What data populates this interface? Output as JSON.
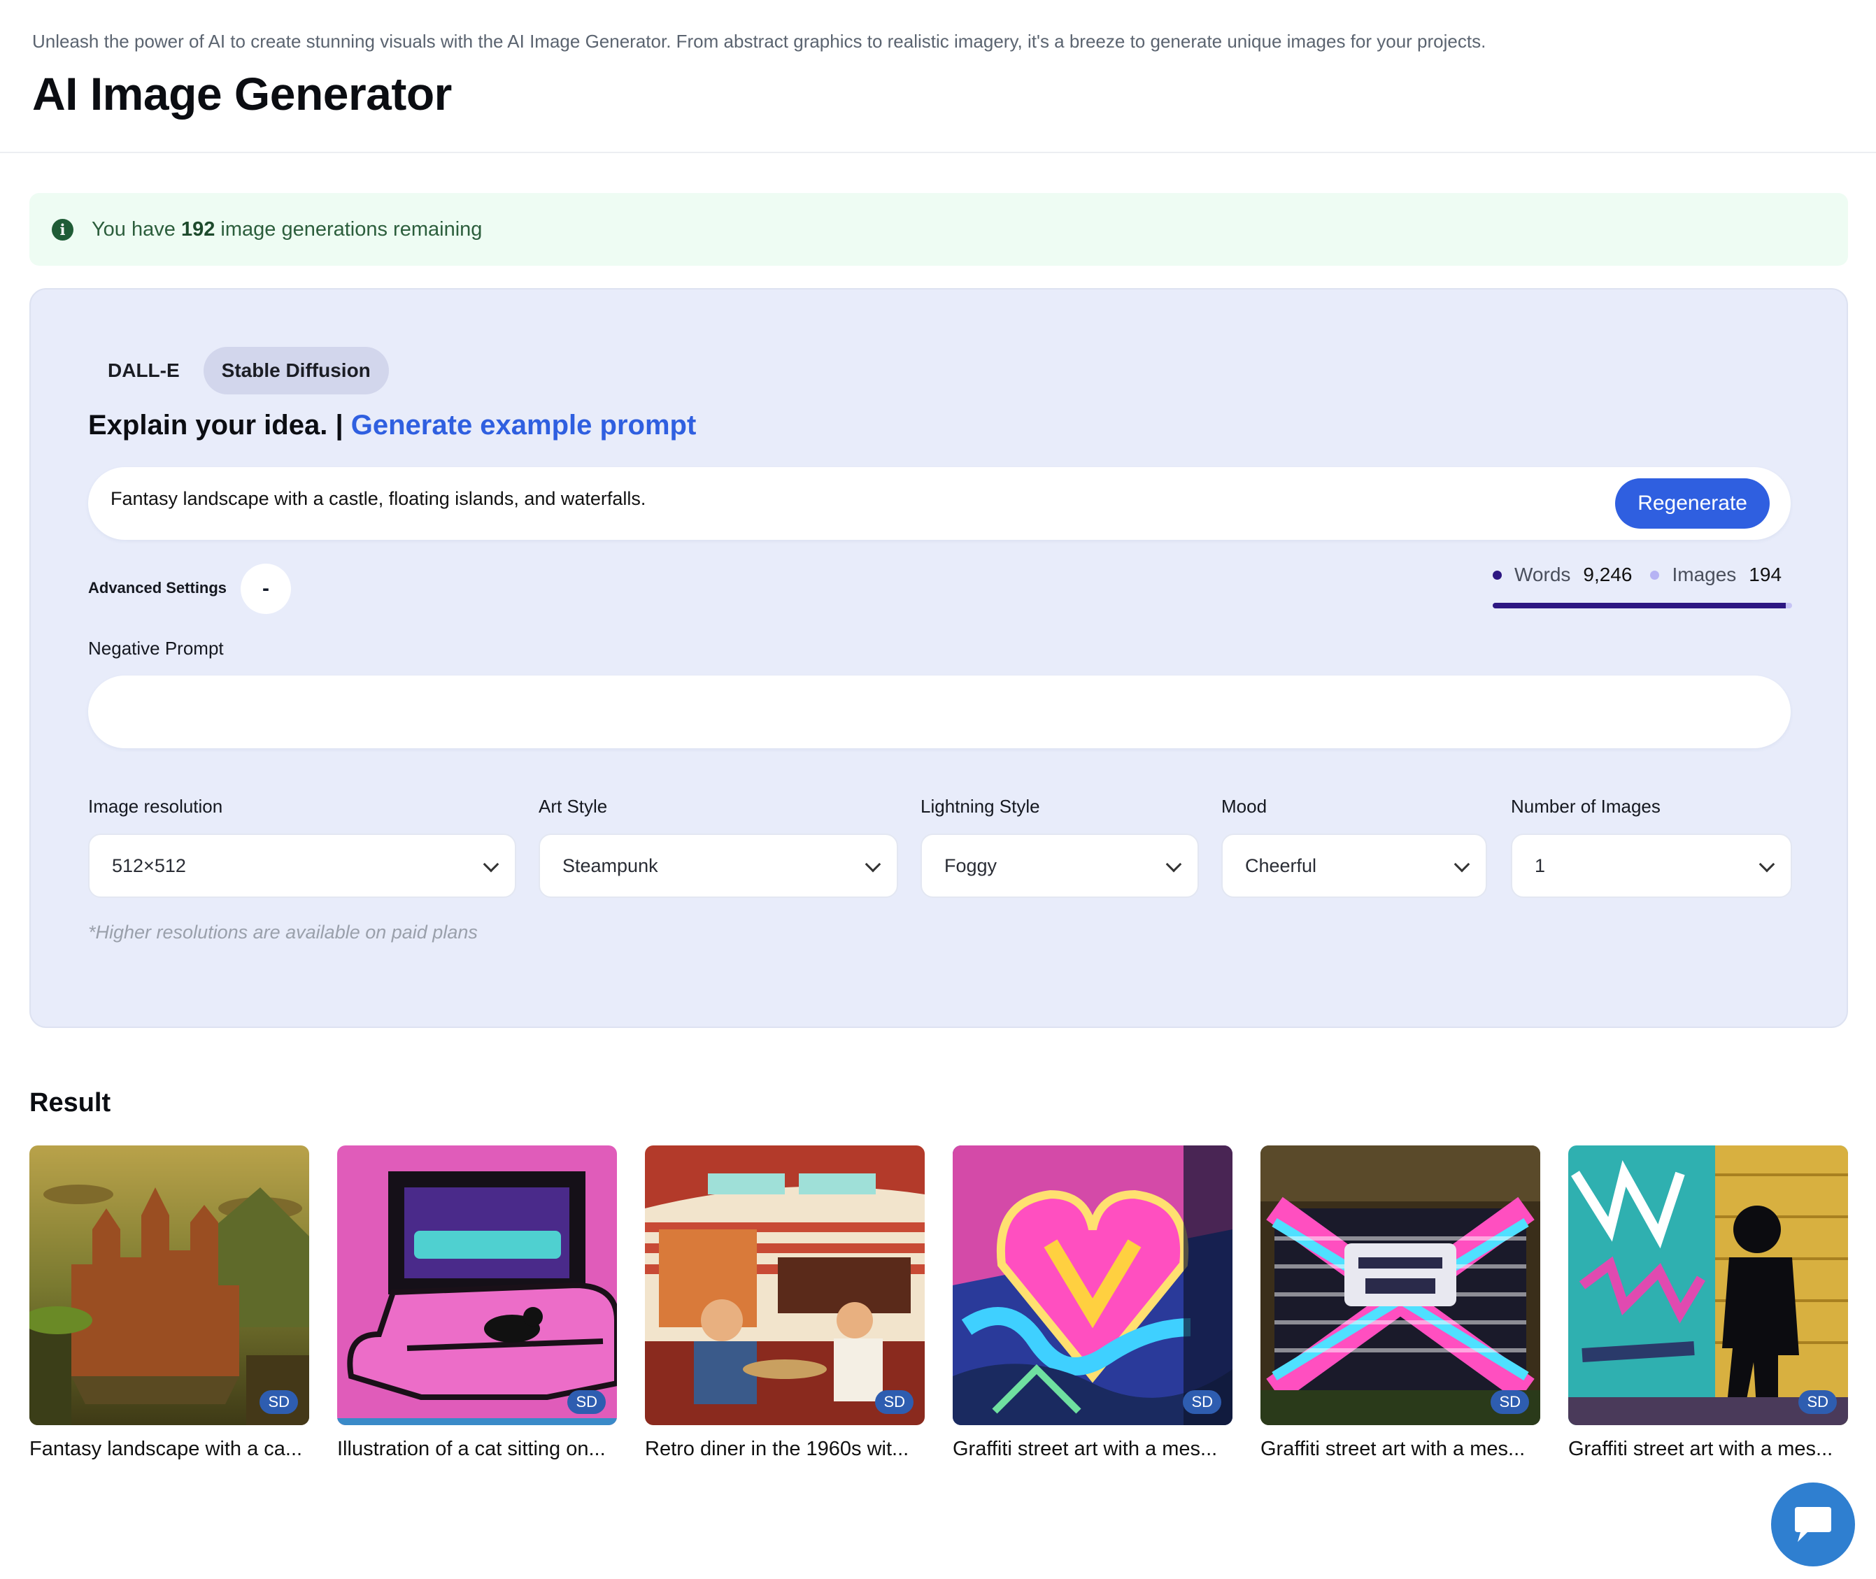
{
  "header": {
    "subtitle": "Unleash the power of AI to create stunning visuals with the AI Image Generator. From abstract graphics to realistic imagery, it's a breeze to generate unique images for your projects.",
    "title": "AI Image Generator"
  },
  "alert": {
    "prefix": "You have",
    "count": "192",
    "suffix": "image generations remaining"
  },
  "tabs": [
    "DALL-E",
    "Stable Diffusion"
  ],
  "active_tab": "Stable Diffusion",
  "idea": {
    "label": "Explain your idea. |",
    "link": "Generate example prompt"
  },
  "prompt": {
    "value": "Fantasy landscape with a castle, floating islands, and waterfalls.",
    "button": "Regenerate"
  },
  "advanced": {
    "label": "Advanced Settings",
    "toggle": "-"
  },
  "usage": {
    "words_label": "Words",
    "words_value": "9,246",
    "images_label": "Images",
    "images_value": "194",
    "words_fraction": 0.98,
    "words_color": "#2d1782",
    "images_color": "#b6b3f4"
  },
  "negative": {
    "label": "Negative Prompt",
    "value": ""
  },
  "fields": {
    "resolution": {
      "label": "Image resolution",
      "value": "512×512"
    },
    "art_style": {
      "label": "Art Style",
      "value": "Steampunk"
    },
    "lighting": {
      "label": "Lightning Style",
      "value": "Foggy"
    },
    "mood": {
      "label": "Mood",
      "value": "Cheerful"
    },
    "count": {
      "label": "Number of Images",
      "value": "1"
    }
  },
  "hint": "*Higher resolutions are available on paid plans",
  "result": {
    "title": "Result",
    "items": [
      {
        "caption": "Fantasy landscape with a ca...",
        "badge": "SD"
      },
      {
        "caption": "Illustration of a cat sitting on...",
        "badge": "SD"
      },
      {
        "caption": "Retro diner in the 1960s wit...",
        "badge": "SD"
      },
      {
        "caption": "Graffiti street art with a mes...",
        "badge": "SD"
      },
      {
        "caption": "Graffiti street art with a mes...",
        "badge": "SD"
      },
      {
        "caption": "Graffiti street art with a mes...",
        "badge": "SD"
      }
    ]
  },
  "colors": {
    "accent": "#2f5fe0",
    "panel": "#e8ecfa",
    "alert_bg": "#eefcf3",
    "badge": "#2e5db0"
  }
}
